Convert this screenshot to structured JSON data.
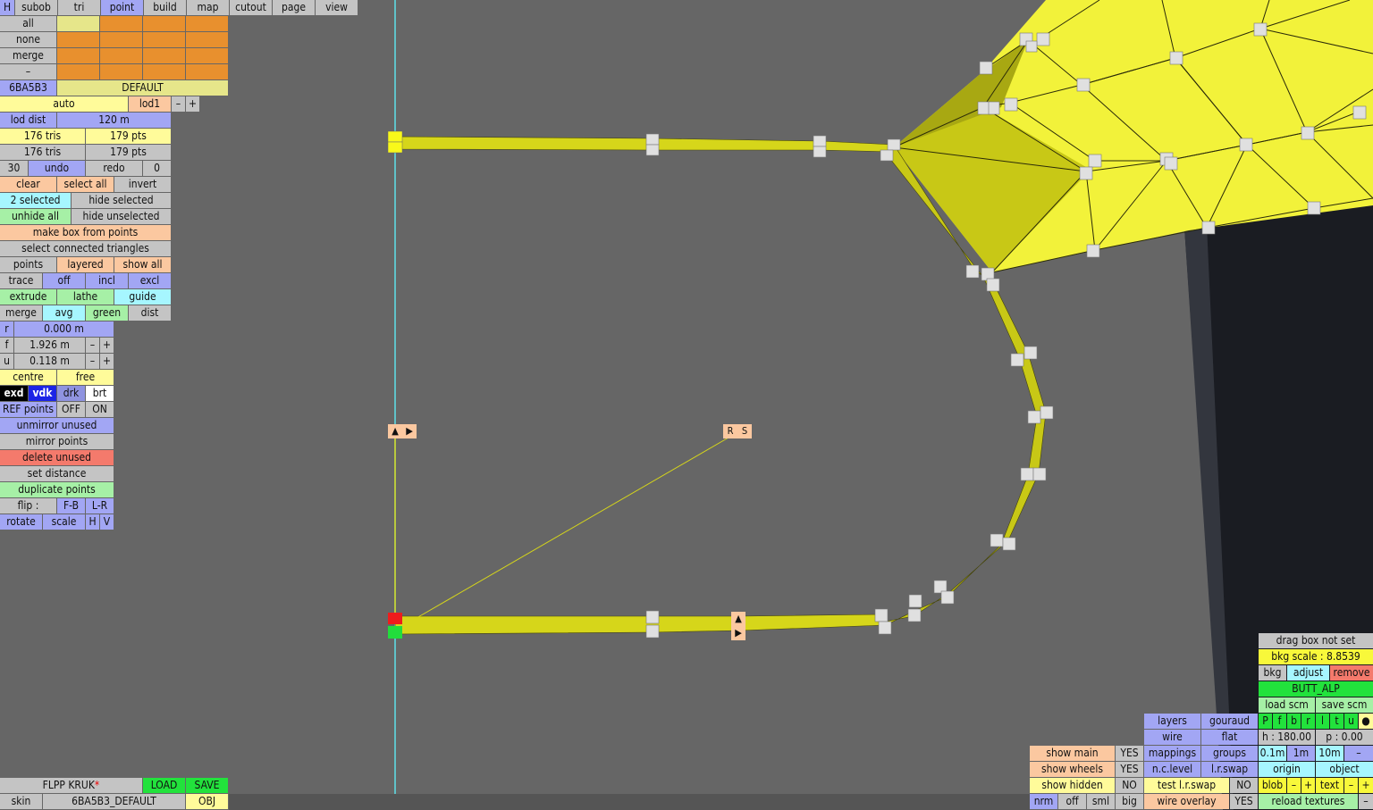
{
  "tabs": [
    "H",
    "subob",
    "tri",
    "point",
    "build",
    "map",
    "cutout",
    "page",
    "view"
  ],
  "active_tab": "point",
  "selection_rows": [
    "all",
    "none",
    "merge",
    "–"
  ],
  "skin_code": "6BA5B3",
  "skin_variant": "DEFAULT",
  "lod": {
    "mode": "auto",
    "level": "lod1",
    "dist_label": "lod dist",
    "dist_value": "120 m",
    "minus": "–",
    "plus": "+"
  },
  "counts": {
    "tris_a": "176 tris",
    "pts_a": "179 pts",
    "tris_b": "176 tris",
    "pts_b": "179 pts"
  },
  "history": {
    "undo_count": "30",
    "undo": "undo",
    "redo": "redo",
    "redo_count": "0"
  },
  "sel_ops": {
    "clear": "clear",
    "select_all": "select all",
    "invert": "invert",
    "selected": "2 selected",
    "hide_selected": "hide selected",
    "unhide_all": "unhide all",
    "hide_unselected": "hide unselected",
    "make_box": "make box from points",
    "select_connected": "select connected triangles"
  },
  "modes": {
    "points": "points",
    "layered": "layered",
    "show_all": "show all",
    "trace": "trace",
    "off": "off",
    "incl": "incl",
    "excl": "excl",
    "extrude": "extrude",
    "lathe": "lathe",
    "guide": "guide",
    "merge": "merge",
    "avg": "avg",
    "green": "green",
    "dist": "dist"
  },
  "params": {
    "r_label": "r",
    "r_value": "0.000 m",
    "f_label": "f",
    "f_value": "1.926 m",
    "u_label": "u",
    "u_value": "0.118 m",
    "minus": "–",
    "plus": "+"
  },
  "pivot": {
    "centre": "centre",
    "free": "free"
  },
  "shade": {
    "exd": "exd",
    "vdk": "vdk",
    "drk": "drk",
    "brt": "brt"
  },
  "ref": {
    "label": "REF points",
    "off": "OFF",
    "on": "ON"
  },
  "actions": {
    "unmirror": "unmirror unused",
    "mirror": "mirror points",
    "delete_unused": "delete unused",
    "set_distance": "set distance",
    "duplicate": "duplicate points",
    "flip": "flip :",
    "fb": "F-B",
    "lr": "L-R",
    "rotate": "rotate",
    "scale": "scale",
    "h": "H",
    "v": "V"
  },
  "markers": {
    "up": "▲",
    "right": "▶",
    "r": "R",
    "s": "S"
  },
  "file": {
    "name": "FLPP KRUK",
    "modified": "*",
    "load": "LOAD",
    "save": "SAVE",
    "skin": "skin",
    "skin_name": "6BA5B3_DEFAULT",
    "obj": "OBJ"
  },
  "view_opts": {
    "show_main": "show main",
    "show_main_v": "YES",
    "show_wheels": "show wheels",
    "show_wheels_v": "YES",
    "show_hidden": "show hidden",
    "show_hidden_v": "NO",
    "nrm": "nrm",
    "off": "off",
    "sml": "sml",
    "big": "big",
    "layers": "layers",
    "gouraud": "gouraud",
    "wire": "wire",
    "flat": "flat",
    "mappings": "mappings",
    "groups": "groups",
    "nc_level": "n.c.level",
    "lr_swap": "l.r.swap",
    "test_lr_swap": "test l.r.swap",
    "test_lr_swap_v": "NO",
    "wire_overlay": "wire overlay",
    "wire_overlay_v": "YES"
  },
  "bkg": {
    "drag_box": "drag box not set",
    "scale": "bkg scale : 8.8539",
    "bkg": "bkg",
    "adjust": "adjust",
    "remove": "remove",
    "name": "BUTT_ALP",
    "load_scm": "load scm",
    "save_scm": "save scm",
    "flags": [
      "P",
      "f",
      "b",
      "r",
      "l",
      "t",
      "u",
      "●"
    ],
    "h": "h : 180.00",
    "p": "p : 0.00",
    "steps": [
      "0.1m",
      "1m",
      "10m",
      "–"
    ],
    "origin": "origin",
    "object": "object",
    "blob": "blob",
    "text": "text",
    "minus": "–",
    "plus": "+",
    "reload": "reload textures"
  },
  "colors": {
    "viewport": "#666666",
    "mesh": "#e6e61a",
    "guide_line": "#5ee0ea"
  }
}
